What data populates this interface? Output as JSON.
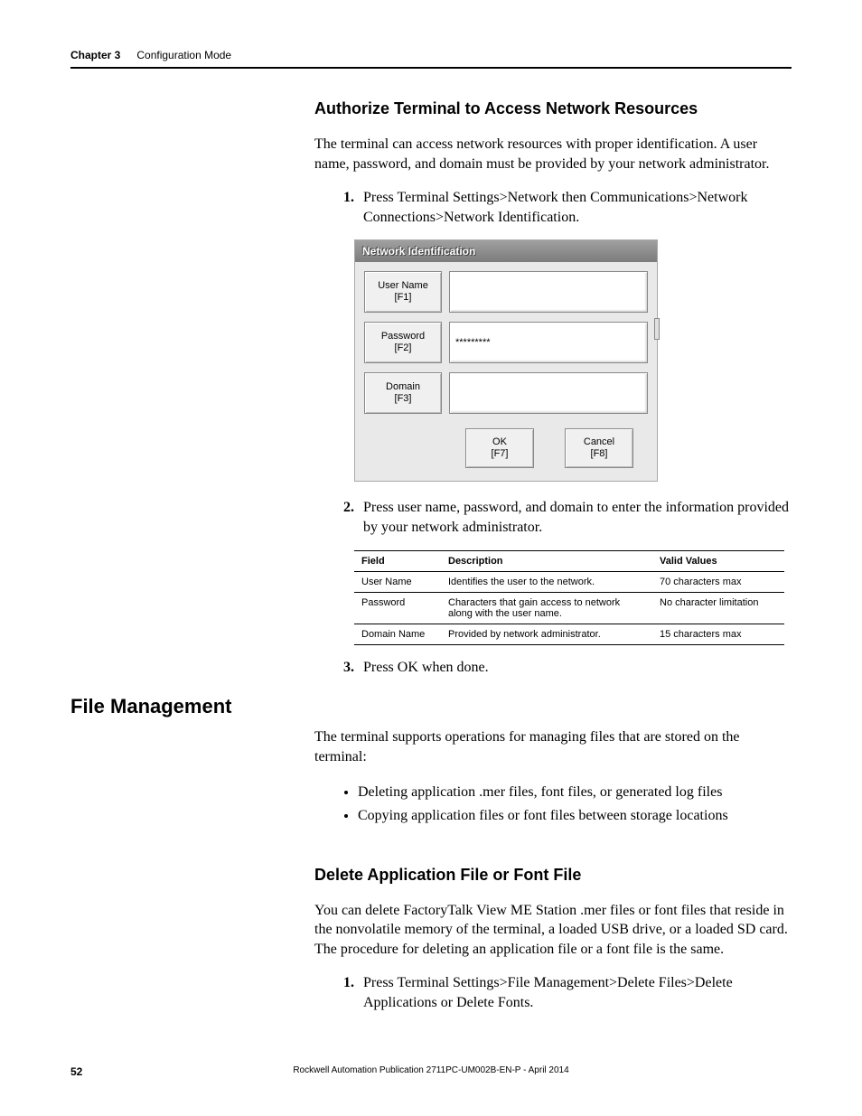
{
  "header": {
    "chapter": "Chapter 3",
    "title": "Configuration Mode"
  },
  "section1": {
    "heading": "Authorize Terminal to Access Network Resources",
    "intro": "The terminal can access network resources with proper identification. A user name, password, and domain must be provided by your network administrator.",
    "step1": "Press Terminal Settings>Network then Communications>Network Connections>Network Identification.",
    "step2": "Press user name, password, and domain to enter the information provided by your network administrator.",
    "step3": "Press OK when done."
  },
  "dialog": {
    "title": "Network Identification",
    "user_label_line1": "User Name",
    "user_label_line2": "[F1]",
    "user_value": "",
    "pwd_label_line1": "Password",
    "pwd_label_line2": "[F2]",
    "pwd_value": "*********",
    "domain_label_line1": "Domain",
    "domain_label_line2": "[F3]",
    "domain_value": "",
    "ok_line1": "OK",
    "ok_line2": "[F7]",
    "cancel_line1": "Cancel",
    "cancel_line2": "[F8]"
  },
  "table": {
    "h_field": "Field",
    "h_desc": "Description",
    "h_valid": "Valid Values",
    "rows": [
      {
        "field": "User Name",
        "desc": "Identifies the user to the network.",
        "valid": "70 characters max"
      },
      {
        "field": "Password",
        "desc": "Characters that gain access to network along with the user name.",
        "valid": "No character limitation"
      },
      {
        "field": "Domain Name",
        "desc": "Provided by network administrator.",
        "valid": "15 characters max"
      }
    ]
  },
  "section2": {
    "side_heading": "File Management",
    "intro": "The terminal supports operations for managing files that are stored on the terminal:",
    "bullet1": "Deleting application .mer files, font files, or generated log files",
    "bullet2": "Copying application files or font files between storage locations",
    "subheading": "Delete Application File or Font File",
    "para": "You can delete FactoryTalk View ME Station .mer files or font files that reside in the nonvolatile memory of the terminal, a loaded USB drive, or a loaded SD card. The procedure for deleting an application file or a font file is the same.",
    "step1": "Press Terminal Settings>File Management>Delete Files>Delete Applications or Delete Fonts."
  },
  "footer": {
    "page": "52",
    "publication": "Rockwell Automation Publication 2711PC-UM002B-EN-P - April 2014"
  }
}
